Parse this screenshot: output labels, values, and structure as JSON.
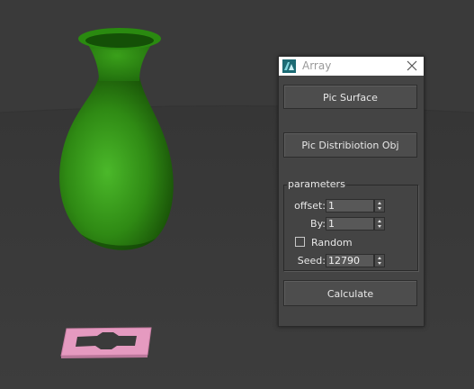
{
  "dialog": {
    "title": "Array",
    "app_icon": "3ds-max-icon",
    "close_icon": "close-icon",
    "pick_surface_label": "Pic Surface",
    "pick_distribution_label": "Pic Distribiotion Obj",
    "calculate_label": "Calculate"
  },
  "parameters": {
    "group_title": "parameters",
    "offset": {
      "label": "offset:",
      "value": "1"
    },
    "by": {
      "label": "By:",
      "value": "1"
    },
    "random": {
      "label": "Random",
      "checked": false
    },
    "seed": {
      "label": "Seed:",
      "value": "12790"
    }
  },
  "colors": {
    "viewport_bg": "#3b3b3b",
    "vase_green": "#3a9a1a",
    "pink_object": "#e8a0c0",
    "dialog_bg": "#444444",
    "titlebar_bg": "#ffffff"
  }
}
